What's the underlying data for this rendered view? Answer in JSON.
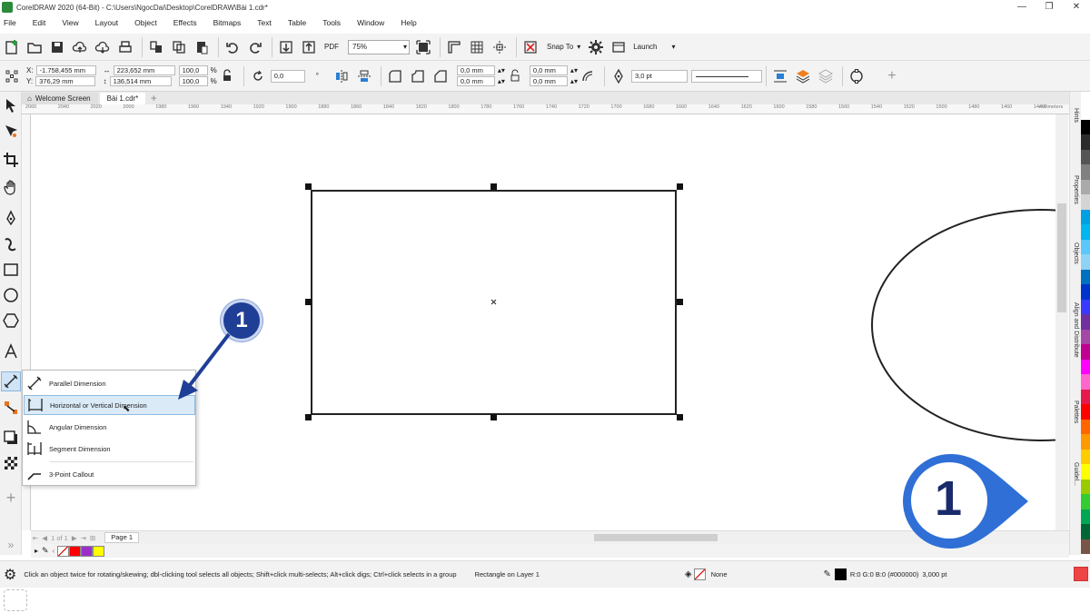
{
  "window": {
    "title": "CorelDRAW 2020 (64-Bit) - C:\\Users\\NgocDai\\Desktop\\CorelDRAW\\Bài 1.cdr*",
    "controls": [
      "—",
      "❐",
      "✕"
    ]
  },
  "menu": [
    "File",
    "Edit",
    "View",
    "Layout",
    "Object",
    "Effects",
    "Bitmaps",
    "Text",
    "Table",
    "Tools",
    "Window",
    "Help"
  ],
  "toolbar": {
    "zoom": "75%",
    "snap_label": "Snap To",
    "launch_label": "Launch",
    "pdf_label": "PDF"
  },
  "property_bar": {
    "x": "-1.758,455 mm",
    "y": "376,29 mm",
    "width": "223,652 mm",
    "height": "136,514 mm",
    "scale_w": "100,0",
    "scale_h": "100,0",
    "percent": "%",
    "rotation": "0,0",
    "degree": "°",
    "corner1": "0,0 mm",
    "corner2": "0,0 mm",
    "corner3": "0,0 mm",
    "corner4": "0,0 mm",
    "outline_width": "3,0 pt",
    "label_x": "X:",
    "label_y": "Y:"
  },
  "tabs": [
    {
      "label": "Welcome Screen"
    },
    {
      "label": "Bài 1.cdr*"
    }
  ],
  "ruler_ticks": [
    "2060",
    "2040",
    "2020",
    "2000",
    "1980",
    "1960",
    "1940",
    "1920",
    "1900",
    "1880",
    "1860",
    "1840",
    "1820",
    "1800",
    "1780",
    "1760",
    "1740",
    "1720",
    "1700",
    "1680",
    "1660",
    "1640",
    "1620",
    "1600",
    "1580",
    "1560",
    "1540",
    "1520",
    "1500",
    "1480",
    "1460",
    "1440",
    "millimeters"
  ],
  "flyout": {
    "items": [
      {
        "label": "Parallel Dimension"
      },
      {
        "label": "Horizontal or Vertical Dimension"
      },
      {
        "label": "Angular Dimension"
      },
      {
        "label": "Segment Dimension"
      },
      {
        "label": "3-Point Callout"
      }
    ]
  },
  "pager": {
    "page_count_text": "1 of 1",
    "page_tab": "Page 1"
  },
  "docker_tabs": [
    "Hints",
    "Properties",
    "Objects",
    "Align and Distribute",
    "Palettes",
    "Guidel..."
  ],
  "status": {
    "hint": "Click an object twice for rotating/skewing; dbl-clicking tool selects all objects; Shift+click multi-selects; Alt+click digs; Ctrl+click selects in a group",
    "selection": "Rectangle on Layer 1",
    "fill": "None",
    "outline_color": "R:0 G:0 B:0 (#000000)",
    "outline_width": "3,000 pt"
  },
  "annotation": {
    "step_badge": "1",
    "watermark_number": "1",
    "accent": "#1f3e96",
    "watermark_color": "#2f6fd6"
  },
  "colors": {
    "palette": [
      "#ffffff",
      "#000000",
      "#2b2b2b",
      "#555555",
      "#808080",
      "#aaaaaa",
      "#d4d4d4",
      "#00a0e3",
      "#00b6ef",
      "#5ac8fa",
      "#8fd3f4",
      "#0070c0",
      "#0033cc",
      "#3a3aff",
      "#7030a0",
      "#a349a4",
      "#c00090",
      "#ff00ff",
      "#ff66cc",
      "#e6194b",
      "#ff0000",
      "#ff6600",
      "#ff9900",
      "#ffcc00",
      "#ffff00",
      "#99cc00",
      "#33cc33",
      "#00a651",
      "#006633",
      "#795548"
    ]
  }
}
